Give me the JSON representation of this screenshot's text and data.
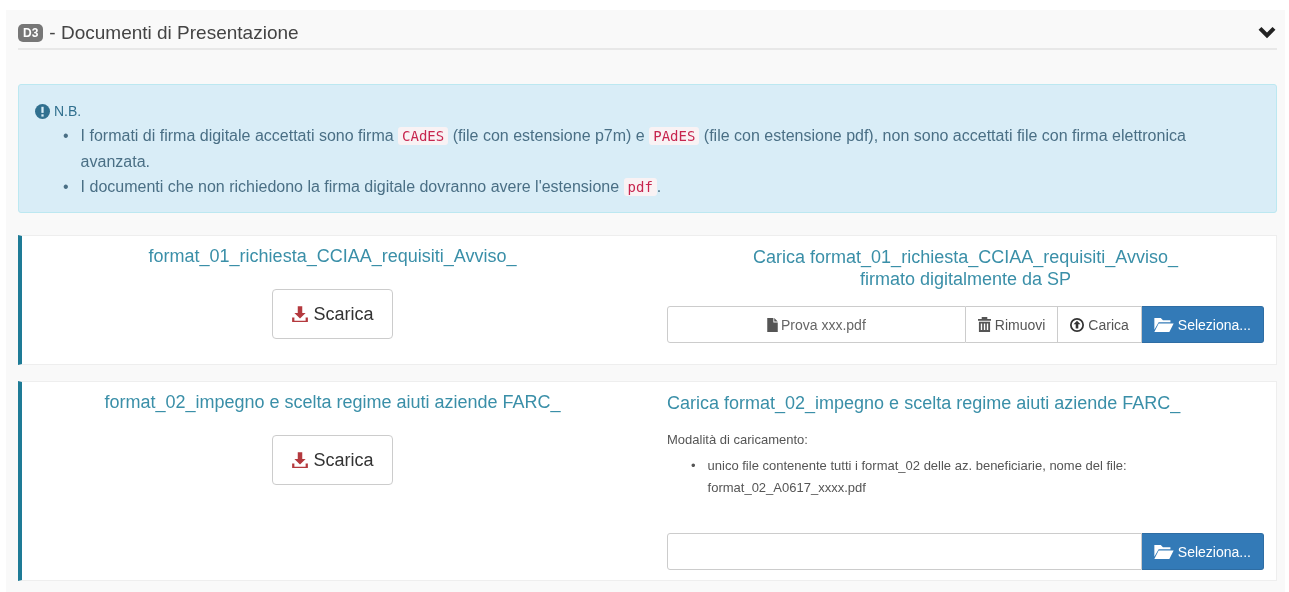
{
  "section": {
    "badge": "D3",
    "title": "- Documenti di Presentazione",
    "expanded": true
  },
  "note": {
    "title": "N.B.",
    "items": [
      {
        "bullet": "•",
        "segments": [
          {
            "kind": "text",
            "text": "I formati di firma digitale accettati sono firma "
          },
          {
            "kind": "code",
            "text": "CAdES"
          },
          {
            "kind": "text",
            "text": " (file con estensione p7m) e "
          },
          {
            "kind": "code",
            "text": "PAdES"
          },
          {
            "kind": "text",
            "text": " (file con estensione pdf), non sono accettati file con firma elettronica avanzata."
          }
        ]
      },
      {
        "bullet": "•",
        "segments": [
          {
            "kind": "text",
            "text": "I documenti che non richiedono la firma digitale dovranno avere l'estensione "
          },
          {
            "kind": "code",
            "text": "pdf"
          },
          {
            "kind": "text",
            "text": "."
          }
        ]
      }
    ]
  },
  "documents": [
    {
      "name": "format_01_richiesta_CCIAA_requisiti_Avviso_",
      "download_button": "Scarica",
      "upload_title": "Carica format_01_richiesta_CCIAA_requisiti_Avviso_\nfirmato digitalmente da SP",
      "upload_title_centered": true,
      "file_name": "Prova xxx.pdf",
      "buttons": [
        {
          "kind": "remove",
          "label": "Rimuovi"
        },
        {
          "kind": "upload",
          "label": "Carica"
        },
        {
          "kind": "select",
          "label": "Seleziona..."
        }
      ]
    },
    {
      "name": "format_02_impegno e scelta regime aiuti aziende FARC_",
      "download_button": "Scarica",
      "upload_title": "Carica format_02_impegno e scelta regime aiuti aziende FARC_",
      "upload_title_centered": false,
      "instructions_label": "Modalità di caricamento:",
      "instructions": [
        {
          "bullet": "•",
          "text": "unico file contenente tutti i format_02 delle az. beneficiarie, nome del file: format_02_A0617_xxxx.pdf"
        }
      ],
      "buttons": [
        {
          "kind": "select",
          "label": "Seleziona..."
        }
      ]
    }
  ]
}
